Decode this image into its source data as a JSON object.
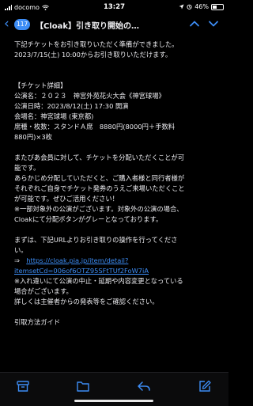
{
  "status": {
    "carrier": "docomo",
    "time": "13:27",
    "battery": "46%"
  },
  "header": {
    "unread_count": "117",
    "subject": "【Cloak】引き取り開始の…"
  },
  "body": {
    "lines": [
      "下記チケットをお引き取りいただく準備ができました。",
      "2023/7/15(土) 10:00からお引き取りいただけます。",
      "",
      "",
      "【チケット詳細】",
      "公演名：２０２３　神宮外苑花火大会《神宮球場》",
      "公演日時：2023/8/12(土) 17:30 開演",
      "会場名：神宮球場 (東京都)",
      "席種・枚数：スタンドＡ席　8880円(8000円＋手数料",
      "880円)×3枚",
      "",
      "またびあ会員に対して、チケットを分配いただくことが可",
      "能です。",
      "あらかじめ分配していただくと、ご購入者様と同行者様が",
      "それぞれご自身でチケット発券のうえご来場いただくこと",
      "が可能です。ぜひご活用ください！",
      "※一部対象外の公演がございます。対象外の公演の場合、",
      "Cloakにて分配ボタンがグレーとなっております。",
      "",
      "まずは、下記URLよりお引き取りの操作を行ってくださ",
      "い。"
    ],
    "link_prefix": "⇒　",
    "link_line1": "https://cloak.pia.jp/item/detail?",
    "link_line2": "itemsetCd=006of6OTZ95SFtTUf2FoW7iA",
    "after_lines": [
      "※入れ違いにて公演の中止・延期や内容変更となっている",
      "場合がございます。",
      "詳しくは主催者からの発表等をご確認ください。",
      "",
      "引取方法ガイド"
    ]
  },
  "toolbar": {
    "icons": [
      "archive-icon",
      "folder-icon",
      "reply-icon",
      "compose-icon"
    ]
  },
  "colors": {
    "accent": "#3d8df5",
    "background": "#000000",
    "text": "#ececf0"
  }
}
